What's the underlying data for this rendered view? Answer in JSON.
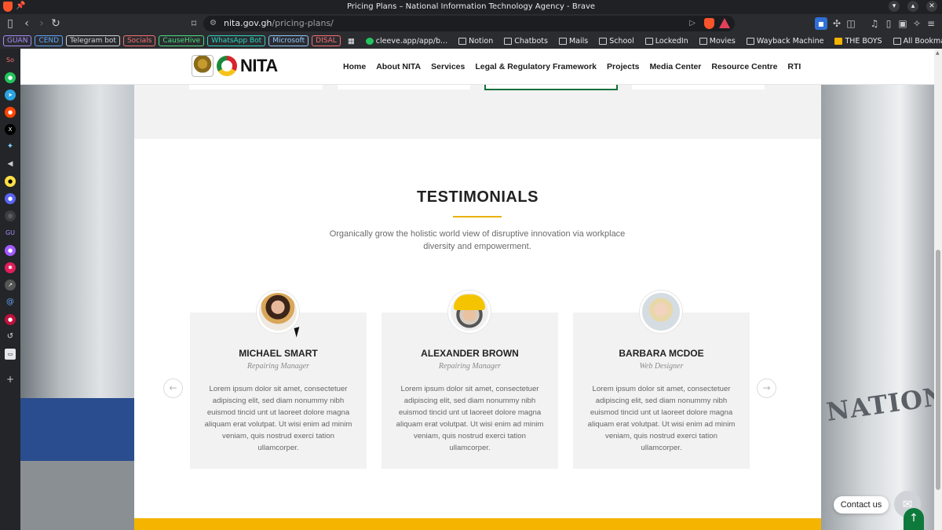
{
  "window": {
    "title": "Pricing Plans – National Information Technology Agency - Brave"
  },
  "toolbar": {
    "url_host": "nita.gov.gh",
    "url_path": "/pricing-plans/"
  },
  "bookmarks": {
    "tags": [
      {
        "label": "GUAN",
        "color": "#a78bfa"
      },
      {
        "label": "CEND",
        "color": "#60a5fa"
      },
      {
        "label": "Telegram bot",
        "color": "#d1d5db"
      },
      {
        "label": "Socials",
        "color": "#f87171"
      },
      {
        "label": "CauseHive",
        "color": "#4ade80"
      },
      {
        "label": "WhatsApp Bot",
        "color": "#2dd4bf"
      },
      {
        "label": "Microsoft",
        "color": "#93c5fd"
      },
      {
        "label": "DISAL",
        "color": "#f87171"
      }
    ],
    "items": [
      "cleeve.app/app/b...",
      "Notion",
      "Chatbots",
      "Mails",
      "School",
      "LockedIn",
      "Movies",
      "Wayback Machine",
      "THE BOYS"
    ],
    "all_bookmarks": "All Bookmarks"
  },
  "sidebar": {
    "top_label": "So",
    "mid_label": "GU"
  },
  "site": {
    "logo_text": "NITA",
    "nav": [
      "Home",
      "About NITA",
      "Services",
      "Legal & Regulatory Framework",
      "Projects",
      "Media Center",
      "Resource Centre",
      "RTI"
    ]
  },
  "testimonials": {
    "title": "TESTIMONIALS",
    "subtitle": "Organically grow the holistic world view of disruptive innovation via workplace diversity and empowerment.",
    "items": [
      {
        "name": "MICHAEL SMART",
        "role": "Repairing Manager",
        "text": "Lorem ipsum dolor sit amet, consectetuer adipiscing elit, sed diam nonummy nibh euismod tincid unt ut laoreet dolore magna aliquam erat volutpat. Ut wisi enim ad minim veniam, quis nostrud exerci tation ullamcorper."
      },
      {
        "name": "ALEXANDER BROWN",
        "role": "Repairing Manager",
        "text": "Lorem ipsum dolor sit amet, consectetuer adipiscing elit, sed diam nonummy nibh euismod tincid unt ut laoreet dolore magna aliquam erat volutpat. Ut wisi enim ad minim veniam, quis nostrud exerci tation ullamcorper."
      },
      {
        "name": "BARBARA MCDOE",
        "role": "Web Designer",
        "text": "Lorem ipsum dolor sit amet, consectetuer adipiscing elit, sed diam nonummy nibh euismod tincid unt ut laoreet dolore magna aliquam erat volutpat. Ut wisi enim ad minim veniam, quis nostrud exerci tation ullamcorper."
      }
    ]
  },
  "background": {
    "building_text": "NATIONAL"
  },
  "widgets": {
    "contact_label": "Contact us"
  },
  "colors": {
    "brand_green": "#0d7a3c",
    "accent_yellow": "#f5b400"
  }
}
